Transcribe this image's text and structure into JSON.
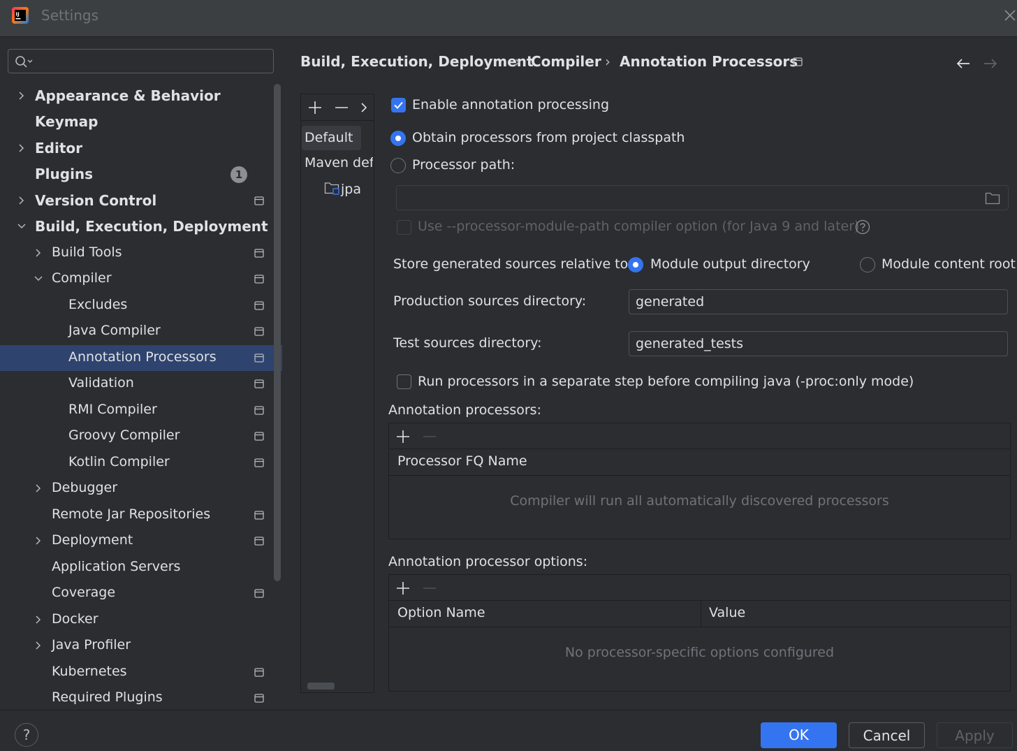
{
  "window": {
    "title": "Settings"
  },
  "search": {
    "placeholder": ""
  },
  "sidebar": {
    "items": [
      {
        "label": "Appearance & Behavior"
      },
      {
        "label": "Keymap"
      },
      {
        "label": "Editor"
      },
      {
        "label": "Plugins",
        "badge": "1"
      },
      {
        "label": "Version Control"
      },
      {
        "label": "Build, Execution, Deployment"
      },
      {
        "label": "Build Tools"
      },
      {
        "label": "Compiler"
      },
      {
        "label": "Excludes"
      },
      {
        "label": "Java Compiler"
      },
      {
        "label": "Annotation Processors",
        "selected": true
      },
      {
        "label": "Validation"
      },
      {
        "label": "RMI Compiler"
      },
      {
        "label": "Groovy Compiler"
      },
      {
        "label": "Kotlin Compiler"
      },
      {
        "label": "Debugger"
      },
      {
        "label": "Remote Jar Repositories"
      },
      {
        "label": "Deployment"
      },
      {
        "label": "Application Servers"
      },
      {
        "label": "Coverage"
      },
      {
        "label": "Docker"
      },
      {
        "label": "Java Profiler"
      },
      {
        "label": "Kubernetes"
      },
      {
        "label": "Required Plugins"
      }
    ]
  },
  "breadcrumb": {
    "items": [
      "Build, Execution, Deployment",
      "Compiler",
      "Annotation Processors"
    ],
    "separator": "›"
  },
  "profiles": {
    "items": [
      "Default",
      "Maven default annotation processors profile",
      "jpa"
    ],
    "selected": "Default"
  },
  "form": {
    "enable_processing": {
      "label": "Enable annotation processing",
      "checked": true
    },
    "obtain_classpath": {
      "label": "Obtain processors from project classpath",
      "selected": true
    },
    "processor_path": {
      "label": "Processor path:",
      "selected": false,
      "value": ""
    },
    "module_path_option": {
      "label": "Use --processor-module-path compiler option (for Java 9 and later)",
      "checked": false,
      "enabled": false
    },
    "store_relative": {
      "label": "Store generated sources relative to:",
      "options": [
        "Module output directory",
        "Module content root"
      ],
      "selected": "Module output directory"
    },
    "production_dir": {
      "label": "Production sources directory:",
      "value": "generated"
    },
    "test_dir": {
      "label": "Test sources directory:",
      "value": "generated_tests"
    },
    "separate_step": {
      "label": "Run processors in a separate step before compiling java (-proc:only mode)",
      "checked": false
    }
  },
  "processors_table": {
    "title": "Annotation processors:",
    "columns": [
      "Processor FQ Name"
    ],
    "empty_text": "Compiler will run all automatically discovered processors"
  },
  "options_table": {
    "title": "Annotation processor options:",
    "columns": [
      "Option Name",
      "Value"
    ],
    "empty_text": "No processor-specific options configured"
  },
  "footer": {
    "help": "?",
    "ok": "OK",
    "cancel": "Cancel",
    "apply": "Apply",
    "apply_enabled": false
  },
  "colors": {
    "accent": "#3574f0",
    "selection": "#2e436e",
    "background": "#2b2d30"
  }
}
